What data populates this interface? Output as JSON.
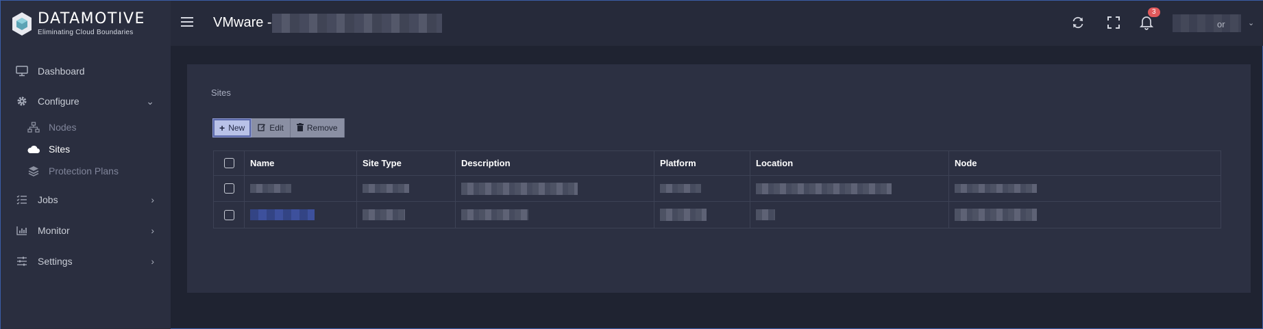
{
  "brand": {
    "name": "DATAMOTIVE",
    "tagline": "Eliminating Cloud Boundaries"
  },
  "sidebar": {
    "items": [
      {
        "label": "Dashboard",
        "icon": "monitor-icon"
      },
      {
        "label": "Configure",
        "icon": "gear-icon",
        "expanded": true
      },
      {
        "label": "Nodes",
        "icon": "network-icon",
        "sub": true
      },
      {
        "label": "Sites",
        "icon": "cloud-icon",
        "sub": true,
        "active": true
      },
      {
        "label": "Protection Plans",
        "icon": "layers-icon",
        "sub": true
      },
      {
        "label": "Jobs",
        "icon": "list-icon"
      },
      {
        "label": "Monitor",
        "icon": "bar-chart-icon"
      },
      {
        "label": "Settings",
        "icon": "sliders-icon"
      }
    ]
  },
  "header": {
    "title": "VMware -",
    "notification_count": "3",
    "user_suffix": "or"
  },
  "main": {
    "page_title": "Sites",
    "toolbar": {
      "new_label": "New",
      "edit_label": "Edit",
      "remove_label": "Remove"
    },
    "table": {
      "columns": [
        "Name",
        "Site Type",
        "Description",
        "Platform",
        "Location",
        "Node"
      ],
      "row_count": 2
    }
  },
  "colors": {
    "background": "#1f2331",
    "sidebar": "#2a2e3f",
    "panel": "#2c3042",
    "badge": "#e0595b",
    "accent": "#b9c2e8"
  }
}
